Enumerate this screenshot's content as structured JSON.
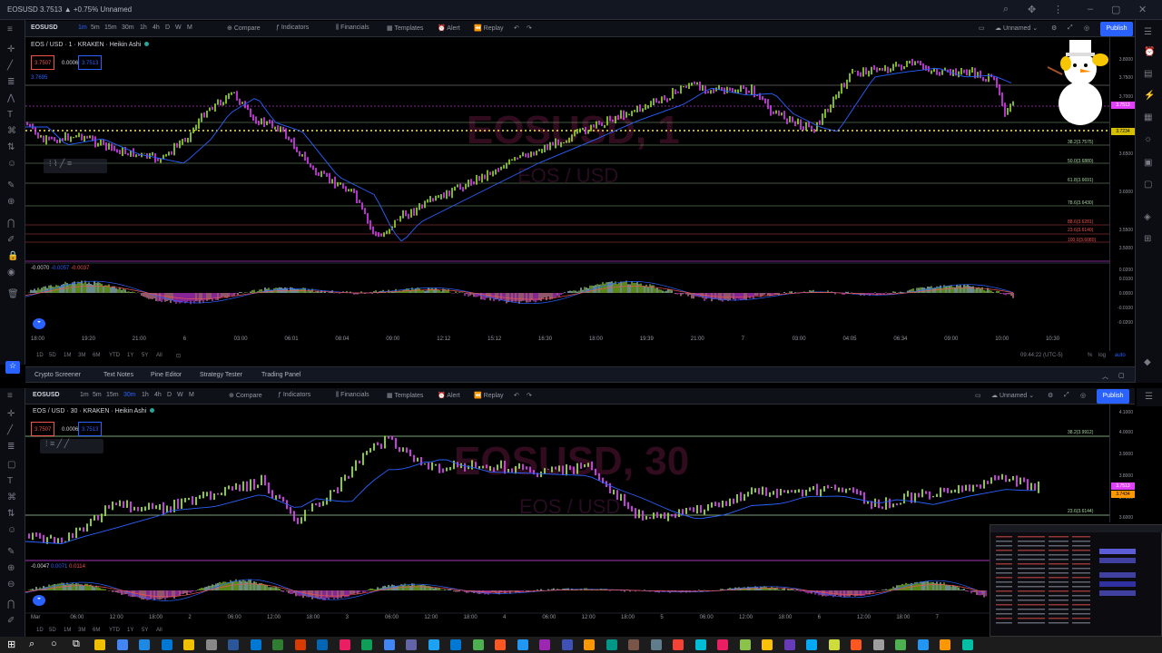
{
  "window": {
    "title": "EOSUSD 3.7513 ▲ +0.75% Unnamed"
  },
  "top_chart": {
    "toolbar": {
      "symbol": "EOSUSD",
      "intervals": [
        "1m",
        "5m",
        "15m",
        "30m",
        "1h",
        "4h",
        "D",
        "W",
        "M"
      ],
      "active_interval": "1m",
      "compare": "Compare",
      "indicators": "Indicators",
      "financials": "Financials",
      "templates": "Templates",
      "alert": "Alert",
      "replay": "Replay",
      "layout_name": "Unnamed",
      "publish": "Publish"
    },
    "legend": {
      "title": "EOS / USD · 1 · KRAKEN · Heikin Ashi",
      "sell": "3.7507",
      "spread": "0.0006",
      "buy": "3.7513",
      "last": "3.7695"
    },
    "watermark": {
      "symbol": "EOSUSD, 1",
      "name": "EOS / USD"
    },
    "price_labels": [
      "3.8000",
      "3.7500",
      "3.7000",
      "3.6500",
      "3.6000",
      "3.5500",
      "3.5000"
    ],
    "price_tags": [
      "3.7513",
      "3.7234"
    ],
    "fib_labels": [
      "38.2(3.7575)",
      "50.0(3.6880)",
      "61.8(3.6691)",
      "78.6(3.6430)",
      "88.6(3.6281)",
      "100.0(3.6080)",
      "23.6(3.6140)"
    ],
    "macd_legend": [
      "-0.0070",
      "-0.0057",
      "-0.0037"
    ],
    "macd_labels": [
      "0.0200",
      "0.0100",
      "0.0000",
      "-0.0100",
      "-0.0200"
    ],
    "time_labels": [
      "18:00",
      "19:20",
      "21:00",
      "6",
      "03:00",
      "06:01",
      "08:04",
      "09:00",
      "12:12",
      "15:12",
      "16:30",
      "18:00",
      "19:39",
      "21:00",
      "7",
      "03:00",
      "04:05",
      "06:34",
      "09:00",
      "10:00",
      "10:30"
    ],
    "bottom": {
      "ranges": [
        "1D",
        "5D",
        "1M",
        "3M",
        "6M",
        "YTD",
        "1Y",
        "5Y",
        "All"
      ],
      "clock": "09:44:22 (UTC-5)",
      "pct": "%",
      "log": "log",
      "auto": "auto"
    }
  },
  "panel_tabs": [
    "Crypto Screener",
    "Text Notes",
    "Pine Editor",
    "Strategy Tester",
    "Trading Panel"
  ],
  "bottom_chart": {
    "toolbar": {
      "symbol": "EOSUSD",
      "intervals": [
        "1m",
        "5m",
        "15m",
        "30m",
        "1h",
        "4h",
        "D",
        "W",
        "M"
      ],
      "active_interval": "30m",
      "compare": "Compare",
      "indicators": "Indicators",
      "financials": "Financials",
      "templates": "Templates",
      "alert": "Alert",
      "replay": "Replay",
      "layout_name": "Unnamed",
      "publish": "Publish"
    },
    "legend": {
      "title": "EOS / USD · 30 · KRAKEN · Heikin Ashi",
      "sell": "3.7507",
      "spread": "0.0006",
      "buy": "3.7513"
    },
    "watermark": {
      "symbol": "EOSUSD, 30",
      "name": "EOS / USD"
    },
    "price_labels": [
      "4.1000",
      "4.0000",
      "3.9000",
      "3.8000",
      "3.7000",
      "3.6000"
    ],
    "price_tags": [
      "3.7513",
      "3.7434"
    ],
    "fib_labels": [
      "38.2(3.9912)",
      "23.6(3.6144)"
    ],
    "macd_legend": [
      "-0.0047",
      "0.0071",
      "0.0114"
    ],
    "time_labels": [
      "Mar",
      "06:00",
      "12:00",
      "18:00",
      "2",
      "06:00",
      "12:00",
      "18:00",
      "3",
      "06:00",
      "12:00",
      "18:00",
      "4",
      "06:00",
      "12:00",
      "18:00",
      "5",
      "06:00",
      "12:00",
      "18:00",
      "6",
      "12:00",
      "18:00",
      "7"
    ],
    "bottom": {
      "ranges": [
        "1D",
        "5D",
        "1M",
        "3M",
        "6M",
        "YTD",
        "1Y",
        "5Y",
        "All"
      ]
    }
  },
  "colors": {
    "up": "#9be22d",
    "down": "#e040fb",
    "ma": "#2962ff",
    "bg": "#000000",
    "fib": "#a7d8a0",
    "accent": "#2962ff"
  }
}
